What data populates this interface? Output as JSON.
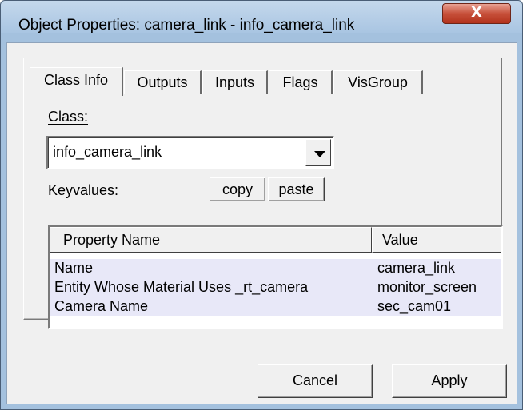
{
  "window": {
    "title": "Object Properties: camera_link - info_camera_link",
    "close_glyph": "X"
  },
  "tabs": [
    {
      "label": "Class Info",
      "active": true
    },
    {
      "label": "Outputs",
      "active": false
    },
    {
      "label": "Inputs",
      "active": false
    },
    {
      "label": "Flags",
      "active": false
    },
    {
      "label": "VisGroup",
      "active": false
    }
  ],
  "class_info": {
    "class_label": "Class:",
    "class_value": "info_camera_link",
    "keyvalues_label": "Keyvalues:",
    "copy_label": "copy",
    "paste_label": "paste"
  },
  "properties": {
    "columns": [
      "Property Name",
      "Value"
    ],
    "rows": [
      {
        "name": "Name",
        "value": "camera_link"
      },
      {
        "name": "Entity Whose Material Uses _rt_camera",
        "value": "monitor_screen"
      },
      {
        "name": "Camera Name",
        "value": "sec_cam01"
      }
    ]
  },
  "footer": {
    "cancel_label": "Cancel",
    "apply_label": "Apply"
  }
}
